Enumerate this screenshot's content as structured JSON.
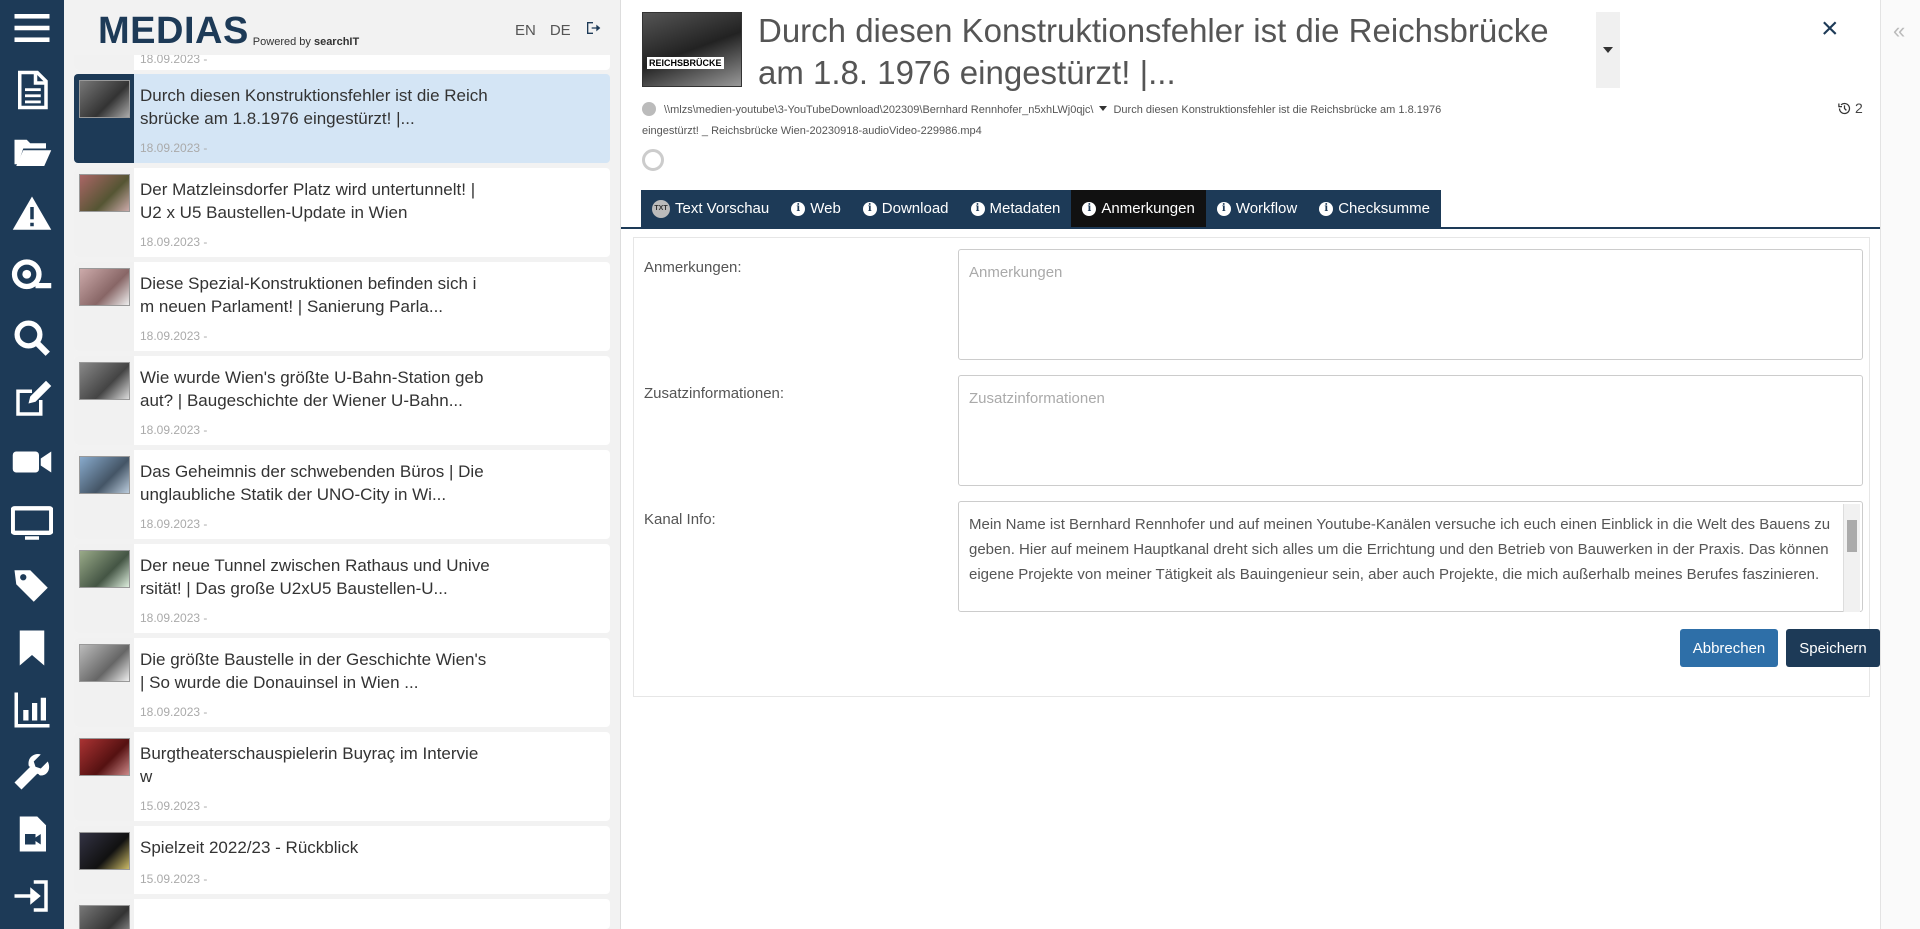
{
  "brand": {
    "logo": "MEDIAS",
    "powered_prefix": "Powered by ",
    "powered_name": "searchIT"
  },
  "lang": {
    "en": "EN",
    "de": "DE"
  },
  "rail": {
    "icons": [
      "menu-icon",
      "document-icon",
      "folder-open-icon",
      "warning-icon",
      "search-ring-icon",
      "search-icon",
      "edit-icon",
      "video-camera-icon",
      "monitor-icon",
      "tags-icon",
      "bookmark-icon",
      "chart-icon",
      "wrench-icon",
      "video-file-icon",
      "sign-in-icon"
    ]
  },
  "list": {
    "top_date": "18.09.2023 -",
    "items": [
      {
        "title": "Durch diesen Konstruktionsfehler ist die Reichsbrücke am 1.8.1976 eingestürzt! |...",
        "date": "18.09.2023 -",
        "active": true
      },
      {
        "title": "Der Matzleinsdorfer Platz wird untertunnelt! | U2 x U5 Baustellen-Update in Wien",
        "date": "18.09.2023 -"
      },
      {
        "title": "Diese Spezial-Konstruktionen befinden sich im neuen Parlament! | Sanierung Parla...",
        "date": "18.09.2023 -"
      },
      {
        "title": "Wie wurde Wien's größte U-Bahn-Station gebaut? | Baugeschichte der Wiener U-Bahn...",
        "date": "18.09.2023 -"
      },
      {
        "title": "Das Geheimnis der schwebenden Büros | Die unglaubliche Statik der UNO-City in Wi...",
        "date": "18.09.2023 -"
      },
      {
        "title": "Der neue Tunnel zwischen Rathaus und Universität! | Das große U2xU5 Baustellen-U...",
        "date": "18.09.2023 -"
      },
      {
        "title": "Die größte Baustelle in der Geschichte Wien's | So wurde die Donauinsel in Wien ...",
        "date": "18.09.2023 -"
      },
      {
        "title": "Burgtheaterschauspielerin Buyraç im Interview",
        "date": "15.09.2023 -"
      },
      {
        "title": "Spielzeit 2022/23 - Rückblick",
        "date": "15.09.2023 -"
      }
    ]
  },
  "detail": {
    "thumb_label": "REICHSBRÜCKE",
    "title": "Durch diesen Konstruktionsfehler ist die Reichsbrücke am 1.8. 1976 eingestürzt! |...",
    "path_dir": "\\\\mlzs\\medien-youtube\\3-YouTubeDownload\\202309\\Bernhard Rennhofer_n5xhLWj0qjc\\",
    "path_file1": "Durch diesen Konstruktionsfehler ist die Reichsbrücke am 1.8.1976",
    "path_file2": "eingestürzt! _ Reichsbrücke Wien-20230918-audioVideo-229986.mp4",
    "version_count": "2",
    "close": "×"
  },
  "tabs": [
    {
      "label": "Text Vorschau",
      "icon": "txt-icon",
      "active": false
    },
    {
      "label": "Web",
      "icon": "info-icon",
      "active": false
    },
    {
      "label": "Download",
      "icon": "info-icon",
      "active": false
    },
    {
      "label": "Metadaten",
      "icon": "info-icon",
      "active": false
    },
    {
      "label": "Anmerkungen",
      "icon": "info-icon",
      "active": true
    },
    {
      "label": "Workflow",
      "icon": "info-icon",
      "active": false
    },
    {
      "label": "Checksumme",
      "icon": "info-icon",
      "active": false
    }
  ],
  "form": {
    "notes_label": "Anmerkungen:",
    "notes_placeholder": "Anmerkungen",
    "extra_label": "Zusatzinformationen:",
    "extra_placeholder": "Zusatzinformationen",
    "channel_label": "Kanal Info:",
    "channel_value": "Mein Name ist Bernhard Rennhofer und auf meinen Youtube-Kanälen versuche ich euch einen Einblick in die Welt des Bauens zu geben. Hier auf meinem Hauptkanal dreht sich alles um die Errichtung und den Betrieb von Bauwerken in der Praxis. Das können eigene Projekte von meiner Tätigkeit als Bauingenieur sein, aber auch Projekte, die mich außerhalb meines Berufes faszinieren.",
    "cancel": "Abbrechen",
    "save": "Speichern"
  },
  "right_strip": {
    "collapse": "«"
  },
  "colors": {
    "primary": "#1d3a57",
    "accent": "#2e6fa8",
    "active_item": "#d4e5f5"
  }
}
